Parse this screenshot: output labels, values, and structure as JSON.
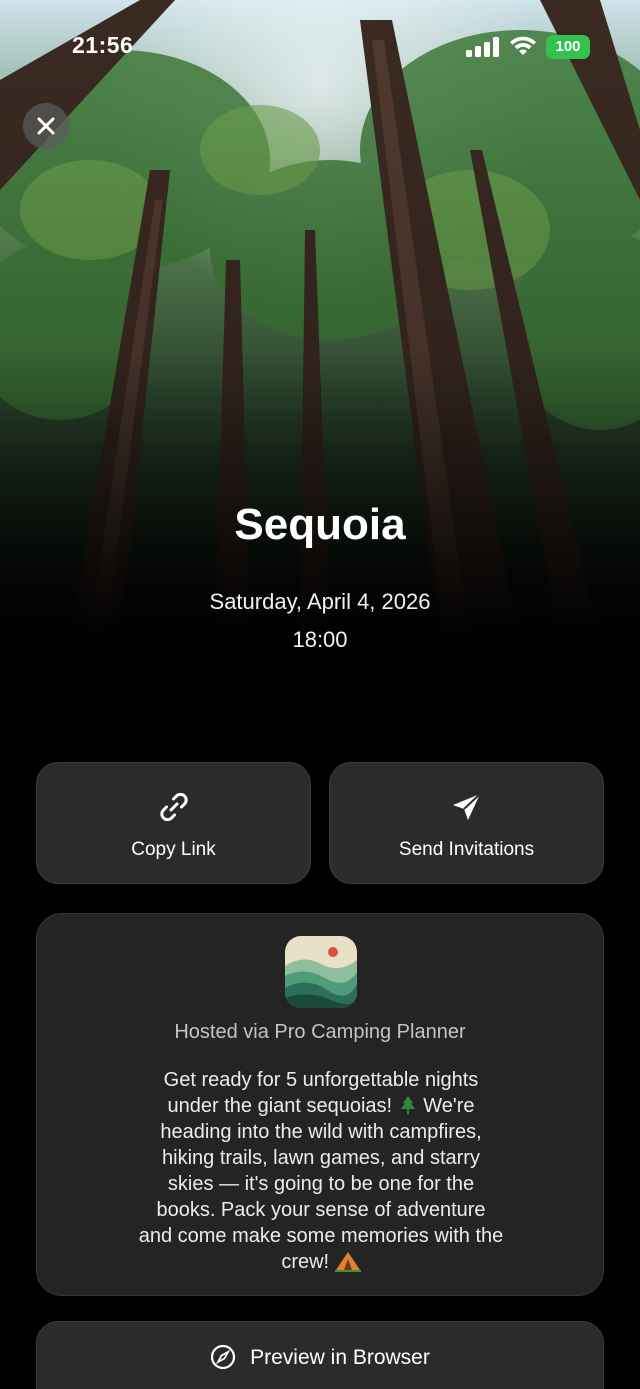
{
  "status_bar": {
    "time": "21:56",
    "battery": "100",
    "battery_color": "#32c24d"
  },
  "event": {
    "title": "Sequoia",
    "date": "Saturday, April 4, 2026",
    "time": "18:00"
  },
  "actions": {
    "copy_link_label": "Copy Link",
    "copy_link_icon": "link-icon",
    "send_invitations_label": "Send Invitations",
    "send_invitations_icon": "paper-plane-icon"
  },
  "host": {
    "app_icon": "mountains-app-icon",
    "hosted_via": "Hosted via Pro Camping Planner",
    "description_lines": [
      "Get ready for 5 unforgettable nights",
      "under the giant sequoias!",
      "We're",
      "heading into the wild with campfires,",
      "hiking trails, lawn games, and starry",
      "skies — it's going to be one for the",
      "books. Pack your sense of adventure",
      "and come make some memories with the",
      "crew!"
    ]
  },
  "preview": {
    "label": "Preview in Browser",
    "icon": "compass-icon"
  },
  "colors": {
    "background": "#000000",
    "card": "#242424",
    "button": "#2b2b2b"
  }
}
